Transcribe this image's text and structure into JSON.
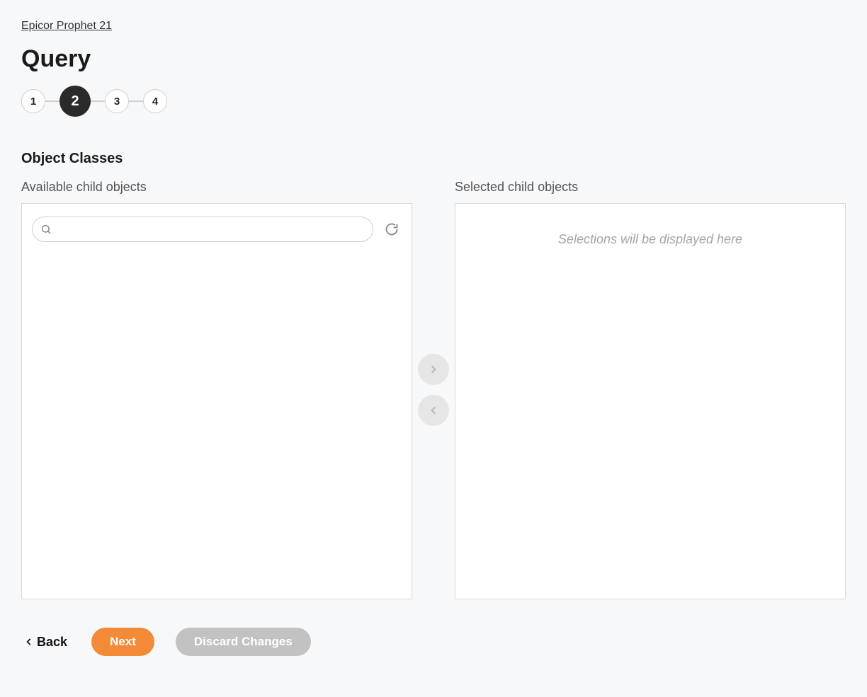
{
  "breadcrumb": {
    "link_label": "Epicor Prophet 21"
  },
  "page": {
    "title": "Query"
  },
  "stepper": {
    "steps": [
      "1",
      "2",
      "3",
      "4"
    ],
    "active_index": 1
  },
  "section": {
    "heading": "Object Classes",
    "available_label": "Available child objects",
    "selected_label": "Selected child objects",
    "selected_empty_text": "Selections will be displayed here",
    "search_placeholder": ""
  },
  "actions": {
    "back": "Back",
    "next": "Next",
    "discard": "Discard Changes"
  }
}
